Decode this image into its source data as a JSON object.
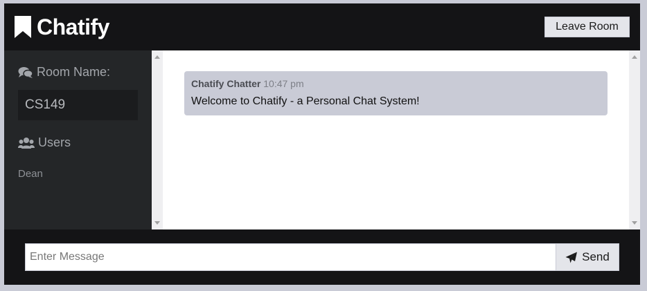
{
  "app": {
    "title": "Chatify",
    "logo_icon": "bookmark-icon",
    "leave_label": "Leave Room"
  },
  "sidebar": {
    "room_heading": "Room Name:",
    "room_icon": "comments-icon",
    "room_name": "CS149",
    "users_heading": "Users",
    "users_icon": "users-icon",
    "users": [
      "Dean"
    ]
  },
  "chat": {
    "messages": [
      {
        "author": "Chatify Chatter",
        "time": "10:47 pm",
        "text": "Welcome to Chatify - a Personal Chat System!"
      }
    ]
  },
  "composer": {
    "placeholder": "Enter Message",
    "value": "",
    "send_label": "Send",
    "send_icon": "paper-plane-icon"
  },
  "colors": {
    "page_background": "#c9cbd6",
    "header_background": "#141416",
    "sidebar_background": "#242628",
    "message_bubble": "#c9cbd6",
    "button_background": "#e4e5ea"
  }
}
